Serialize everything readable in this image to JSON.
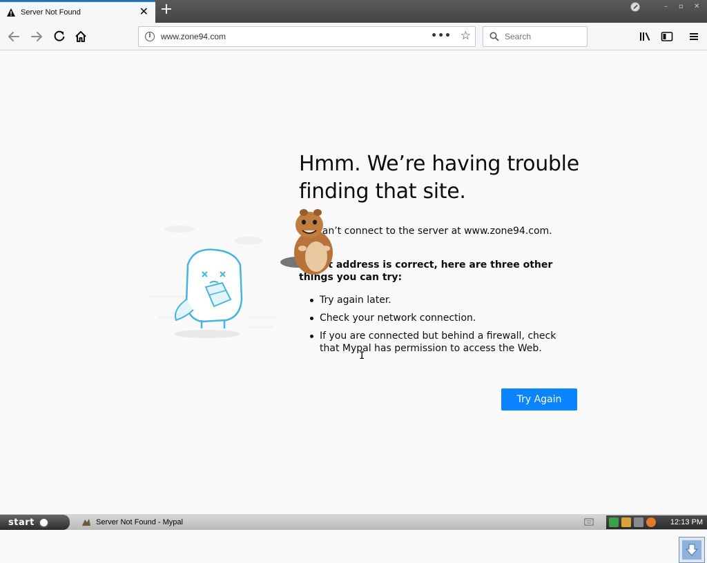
{
  "window": {
    "tab_title": "Server Not Found",
    "tab_close": "✕",
    "newtab": "+",
    "controls": [
      "–",
      "▫",
      "✕"
    ]
  },
  "nav": {
    "url": "www.zone94.com",
    "page_actions": "•••",
    "bookmark_star": "☆",
    "search_placeholder": "Search"
  },
  "page": {
    "heading": "Hmm. We’re having trouble finding that site.",
    "description": "We can’t connect to the server at www.zone94.com.",
    "advice": "If that address is correct, here are three other things you can try:",
    "tips": [
      "Try again later.",
      "Check your network connection.",
      "If you are connected but behind a firewall, check that Mypal has permission to access the Web."
    ],
    "try_again_label": "Try Again",
    "text_cursor": "I"
  },
  "taskbar": {
    "start_label": "start",
    "task_label": "Server Not Found - Mypal",
    "clock": "12:13 PM"
  },
  "colors": {
    "accent": "#0a84ff",
    "page_bg": "#f9f9fa",
    "toolbar_bg": "#f5f6f7"
  }
}
